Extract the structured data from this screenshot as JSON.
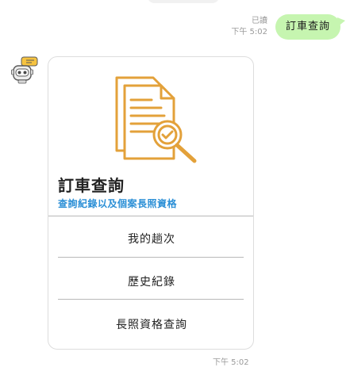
{
  "outgoing": {
    "read_status": "已讀",
    "time": "下午 5:02",
    "text": "訂車查詢"
  },
  "card": {
    "title": "訂車查詢",
    "subtitle": "查詢紀錄以及個案長照資格",
    "actions": [
      {
        "label": "我的趟次"
      },
      {
        "label": "歷史紀錄"
      },
      {
        "label": "長照資格查詢"
      }
    ]
  },
  "incoming": {
    "time": "下午 5:02"
  },
  "colors": {
    "bubble_out": "#c6f5b0",
    "subtitle_blue": "#2b8fd6",
    "icon_orange": "#e3a13a"
  }
}
